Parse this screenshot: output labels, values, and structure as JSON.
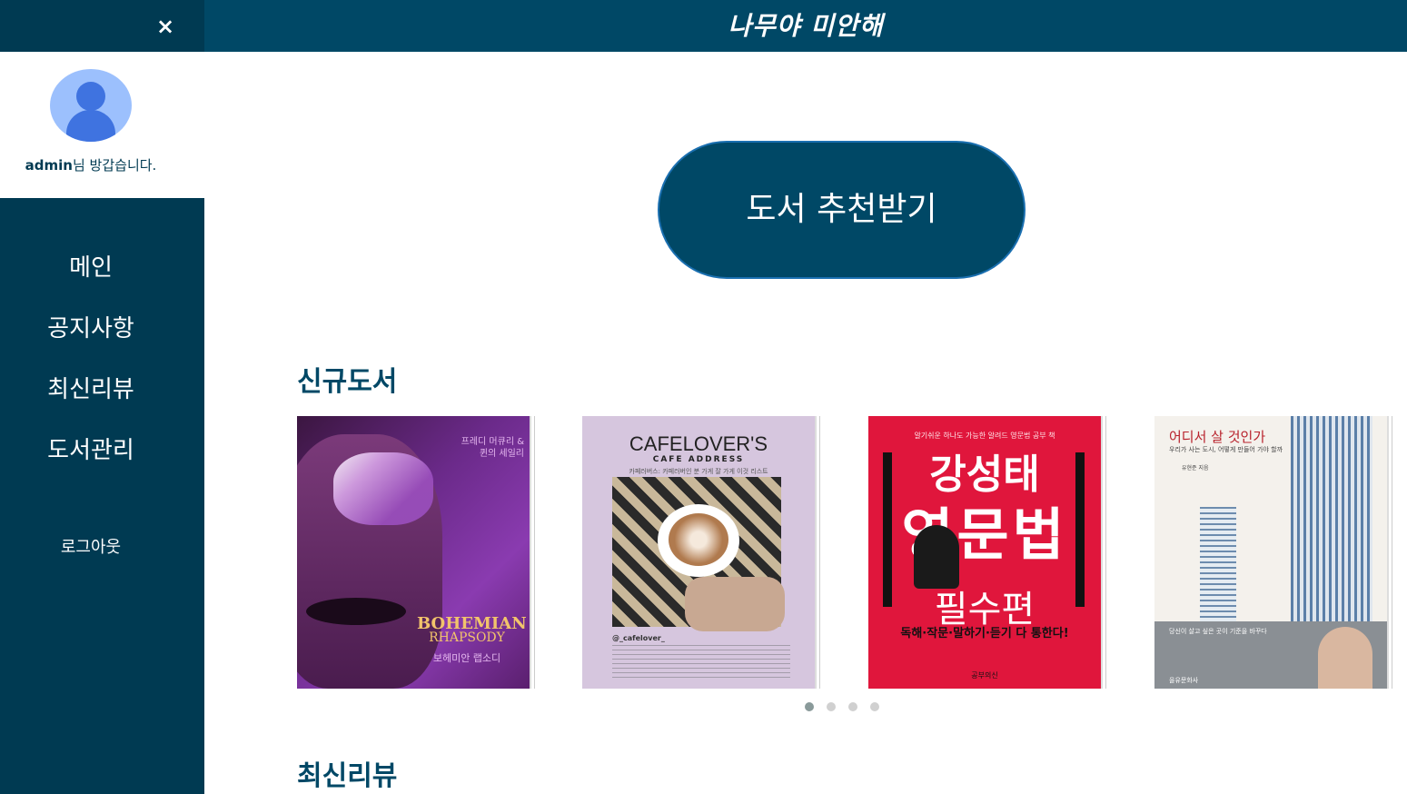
{
  "header": {
    "brand": "나무야 미안해",
    "close_label": "×"
  },
  "sidebar": {
    "greeting_user": "admin",
    "greeting_suffix": "님 방갑습니다.",
    "items": [
      {
        "label": "메인"
      },
      {
        "label": "공지사항"
      },
      {
        "label": "최신리뷰"
      },
      {
        "label": "도서관리"
      }
    ],
    "logout_label": "로그아웃"
  },
  "main": {
    "recommend_button": "도서 추천받기",
    "new_books_title": "신규도서",
    "latest_reviews_title": "최신리뷰",
    "books": [
      {
        "cover_en": "BOHEMIAN",
        "cover_en2": "RHAPSODY",
        "cover_ko": "보헤미안 랩소디",
        "cover_sub": "프레디 머큐리 & 퀸의 세일리"
      },
      {
        "cover_title": "CAFELOVER'S",
        "cover_subtitle": "CAFE ADDRESS",
        "cover_note": "카페러버스: 카페러버인 분 가게 잘 가게 이것 리스트",
        "cover_handle": "@_cafelover_"
      },
      {
        "cover_top": "알기쉬운 하나도 가능한 알려드 영문법 공부 책",
        "cover_author": "강성태",
        "cover_main": "영문법",
        "cover_sub": "필수편",
        "cover_tag": "독해·작문·말하기·듣기 다 통한다!",
        "cover_pub": "공부의신"
      },
      {
        "cover_title": "어디서 살 것인가",
        "cover_subtitle": "우리가 사는 도시, 어떻게 만들어 가야 할까",
        "cover_author": "유현준 지음",
        "cover_blurb": "당신이 살고 싶은 곳이 기준을 바꾸다",
        "cover_pub": "을유문화사"
      }
    ],
    "carousel_pages": 4,
    "carousel_active": 1
  },
  "colors": {
    "primary": "#004866",
    "sidebar_dark": "#003a52",
    "avatar_bg": "#9cc0fd",
    "avatar_fg": "#3f73e0"
  }
}
